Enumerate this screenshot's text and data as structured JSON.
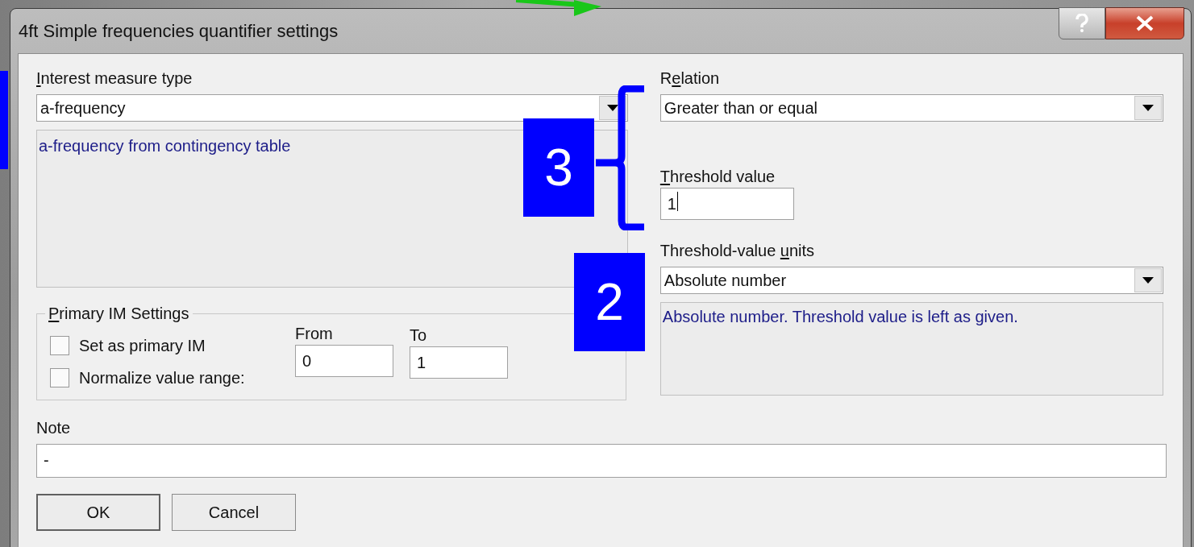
{
  "window": {
    "title": "4ft Simple frequencies quantifier settings"
  },
  "interest_measure": {
    "label": [
      {
        "text": "I",
        "underlined": true
      },
      {
        "text": "nterest measure type",
        "underlined": false
      }
    ],
    "value": "a-frequency",
    "description": "a-frequency from contingency table"
  },
  "relation": {
    "label": [
      {
        "text": "R",
        "underlined": false
      },
      {
        "text": "e",
        "underlined": true
      },
      {
        "text": "lation",
        "underlined": false
      }
    ],
    "value": "Greater than or equal"
  },
  "threshold": {
    "label": [
      {
        "text": "T",
        "underlined": true
      },
      {
        "text": "hreshold value",
        "underlined": false
      }
    ],
    "value": "1",
    "focused": true
  },
  "units": {
    "label": [
      {
        "text": "Threshold-value ",
        "underlined": false
      },
      {
        "text": "u",
        "underlined": true
      },
      {
        "text": "nits",
        "underlined": false
      }
    ],
    "value": "Absolute number",
    "description": "Absolute number. Threshold value is left as given."
  },
  "primary_im": {
    "legend": [
      {
        "text": "P",
        "underlined": true
      },
      {
        "text": "rimary IM Settings",
        "underlined": false
      }
    ],
    "checkboxes": [
      {
        "label": "Set as primary IM",
        "checked": false
      },
      {
        "label": "Normalize value range:",
        "checked": false
      }
    ],
    "from": {
      "label": "From",
      "value": "0"
    },
    "to": {
      "label": "To",
      "value": "1"
    }
  },
  "note": {
    "label": "Note",
    "value": "-"
  },
  "buttons": [
    {
      "label": "OK",
      "default": true
    },
    {
      "label": "Cancel",
      "default": false
    }
  ],
  "annotations": [
    {
      "label": "3"
    },
    {
      "label": "2"
    }
  ]
}
